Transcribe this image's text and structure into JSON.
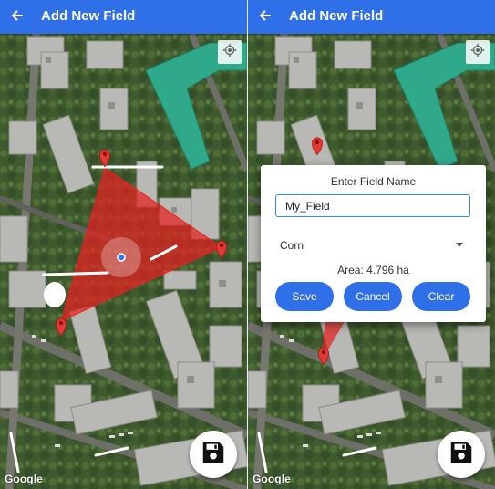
{
  "screens": [
    {
      "appbar": {
        "title": "Add New Field"
      },
      "attribution": "Google"
    },
    {
      "appbar": {
        "title": "Add New Field"
      },
      "attribution": "Google",
      "dialog": {
        "title": "Enter Field Name",
        "name_value": "My_Field",
        "crop_selected": "Corn",
        "area_text": "Area: 4.796 ha",
        "buttons": {
          "save": "Save",
          "cancel": "Cancel",
          "clear": "Clear"
        }
      }
    }
  ],
  "colors": {
    "appbar": "#2f6fe8",
    "polygon_fill": "#e82020",
    "marker": "#e53935",
    "button": "#2f6fe8",
    "input_border": "#2f8df0"
  },
  "icons": {
    "back": "arrow-left-icon",
    "locate": "my-location-icon",
    "save_fab": "floppy-disk-icon",
    "marker": "map-pin-icon",
    "dropdown": "chevron-down-icon"
  }
}
